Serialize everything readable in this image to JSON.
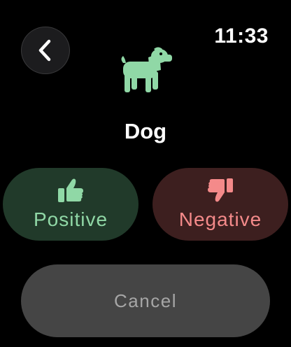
{
  "status_bar": {
    "time": "11:33"
  },
  "header": {
    "back_icon": "chevron-left-icon",
    "subject_icon": "dog-icon",
    "title": "Dog"
  },
  "actions": {
    "positive": {
      "label": "Positive",
      "icon": "thumbs-up-icon",
      "color": "#90d8a6",
      "background": "#213a2a"
    },
    "negative": {
      "label": "Negative",
      "icon": "thumbs-down-icon",
      "color": "#f48a8a",
      "background": "#3d1f1f"
    },
    "cancel": {
      "label": "Cancel",
      "color": "#a6a6a6",
      "background": "#454545"
    }
  }
}
